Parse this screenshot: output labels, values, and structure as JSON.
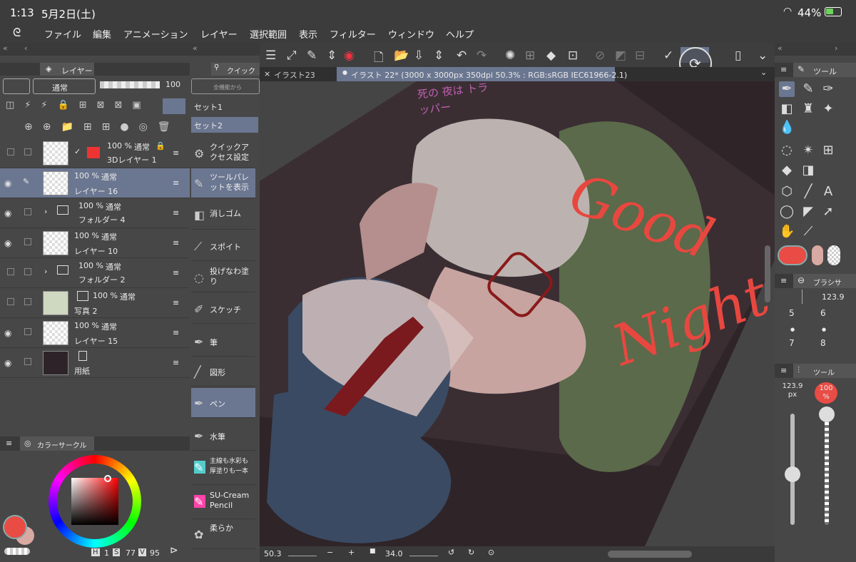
{
  "status": {
    "time": "1:13",
    "date": "5月2日(土)",
    "battery": "44%"
  },
  "menu": [
    "ファイル",
    "編集",
    "アニメーション",
    "レイヤー",
    "選択範囲",
    "表示",
    "フィルター",
    "ウィンドウ",
    "ヘルプ"
  ],
  "layer_panel": {
    "tab_label": "レイヤー",
    "blend_mode": "通常",
    "opacity": "100",
    "layers": [
      {
        "opacity": "100 %",
        "mode": "通常",
        "name": "3Dレイヤー 1"
      },
      {
        "opacity": "100 %",
        "mode": "通常",
        "name": "レイヤー 16"
      },
      {
        "opacity": "100 %",
        "mode": "通常",
        "name": "フォルダー 4"
      },
      {
        "opacity": "100 %",
        "mode": "通常",
        "name": "レイヤー 10"
      },
      {
        "opacity": "100 %",
        "mode": "通常",
        "name": "フォルダー 2"
      },
      {
        "opacity": "100 %",
        "mode": "通常",
        "name": "写真 2"
      },
      {
        "opacity": "100 %",
        "mode": "通常",
        "name": "レイヤー 15"
      },
      {
        "opacity": "",
        "mode": "",
        "name": "用紙"
      }
    ]
  },
  "color_panel": {
    "tab_label": "カラーサークル",
    "h_label": "H",
    "h": "1",
    "s_label": "S",
    "s": "77",
    "v_label": "V",
    "v": "95",
    "main_color": "#e84c44",
    "sub_color": "#d9a9a3"
  },
  "quick_panel": {
    "tab_label": "クイック",
    "search_placeholder": "全機能から",
    "sets": [
      "セット1",
      "セット2"
    ],
    "items": [
      {
        "icon": "quick-access-settings-icon",
        "label": "クイックアクセス設定"
      },
      {
        "icon": "tool-palette-icon",
        "label": "ツールパレットを表示"
      },
      {
        "icon": "eraser-icon",
        "label": "消しゴム"
      },
      {
        "icon": "eyedropper-icon",
        "label": "スポイト"
      },
      {
        "icon": "lasso-fill-icon",
        "label": "投げなわ塗り"
      },
      {
        "icon": "sketch-icon",
        "label": "スケッチ"
      },
      {
        "icon": "brush-icon",
        "label": "筆"
      },
      {
        "icon": "shape-icon",
        "label": "図形"
      },
      {
        "icon": "pen-icon",
        "label": "ペン"
      },
      {
        "icon": "watercolor-icon",
        "label": "水筆"
      },
      {
        "icon": "watercolor-brush-icon",
        "label": "主線も水彩も厚塗りも一本"
      },
      {
        "icon": "pencil-icon",
        "label": "SU-Cream Pencil"
      },
      {
        "icon": "soft-icon",
        "label": "柔らか"
      }
    ]
  },
  "tabs": {
    "inactive": "イラスト23",
    "active": "イラスト 22* (3000 x 3000px 350dpi 50.3% : RGB:sRGB IEC61966-2.1)"
  },
  "canvas": {
    "handwriting": "死の 夜は トラッパー",
    "lettering": [
      "Good",
      "Night"
    ]
  },
  "canvas_footer": {
    "zoom": "50.3",
    "angle": "34.0"
  },
  "right_panel": {
    "tool_tab": "ツール",
    "brush_tab": "ブラシサ",
    "brush_size": "123.9",
    "sizes": [
      "5",
      "6",
      "7",
      "8"
    ],
    "tool_prop_tab": "ツール",
    "size_readout": "123.9",
    "size_unit": "px",
    "opacity_readout": "100",
    "opacity_unit": "%",
    "size_slider_level": 0.45,
    "opacity_slider_level": 1.0
  }
}
